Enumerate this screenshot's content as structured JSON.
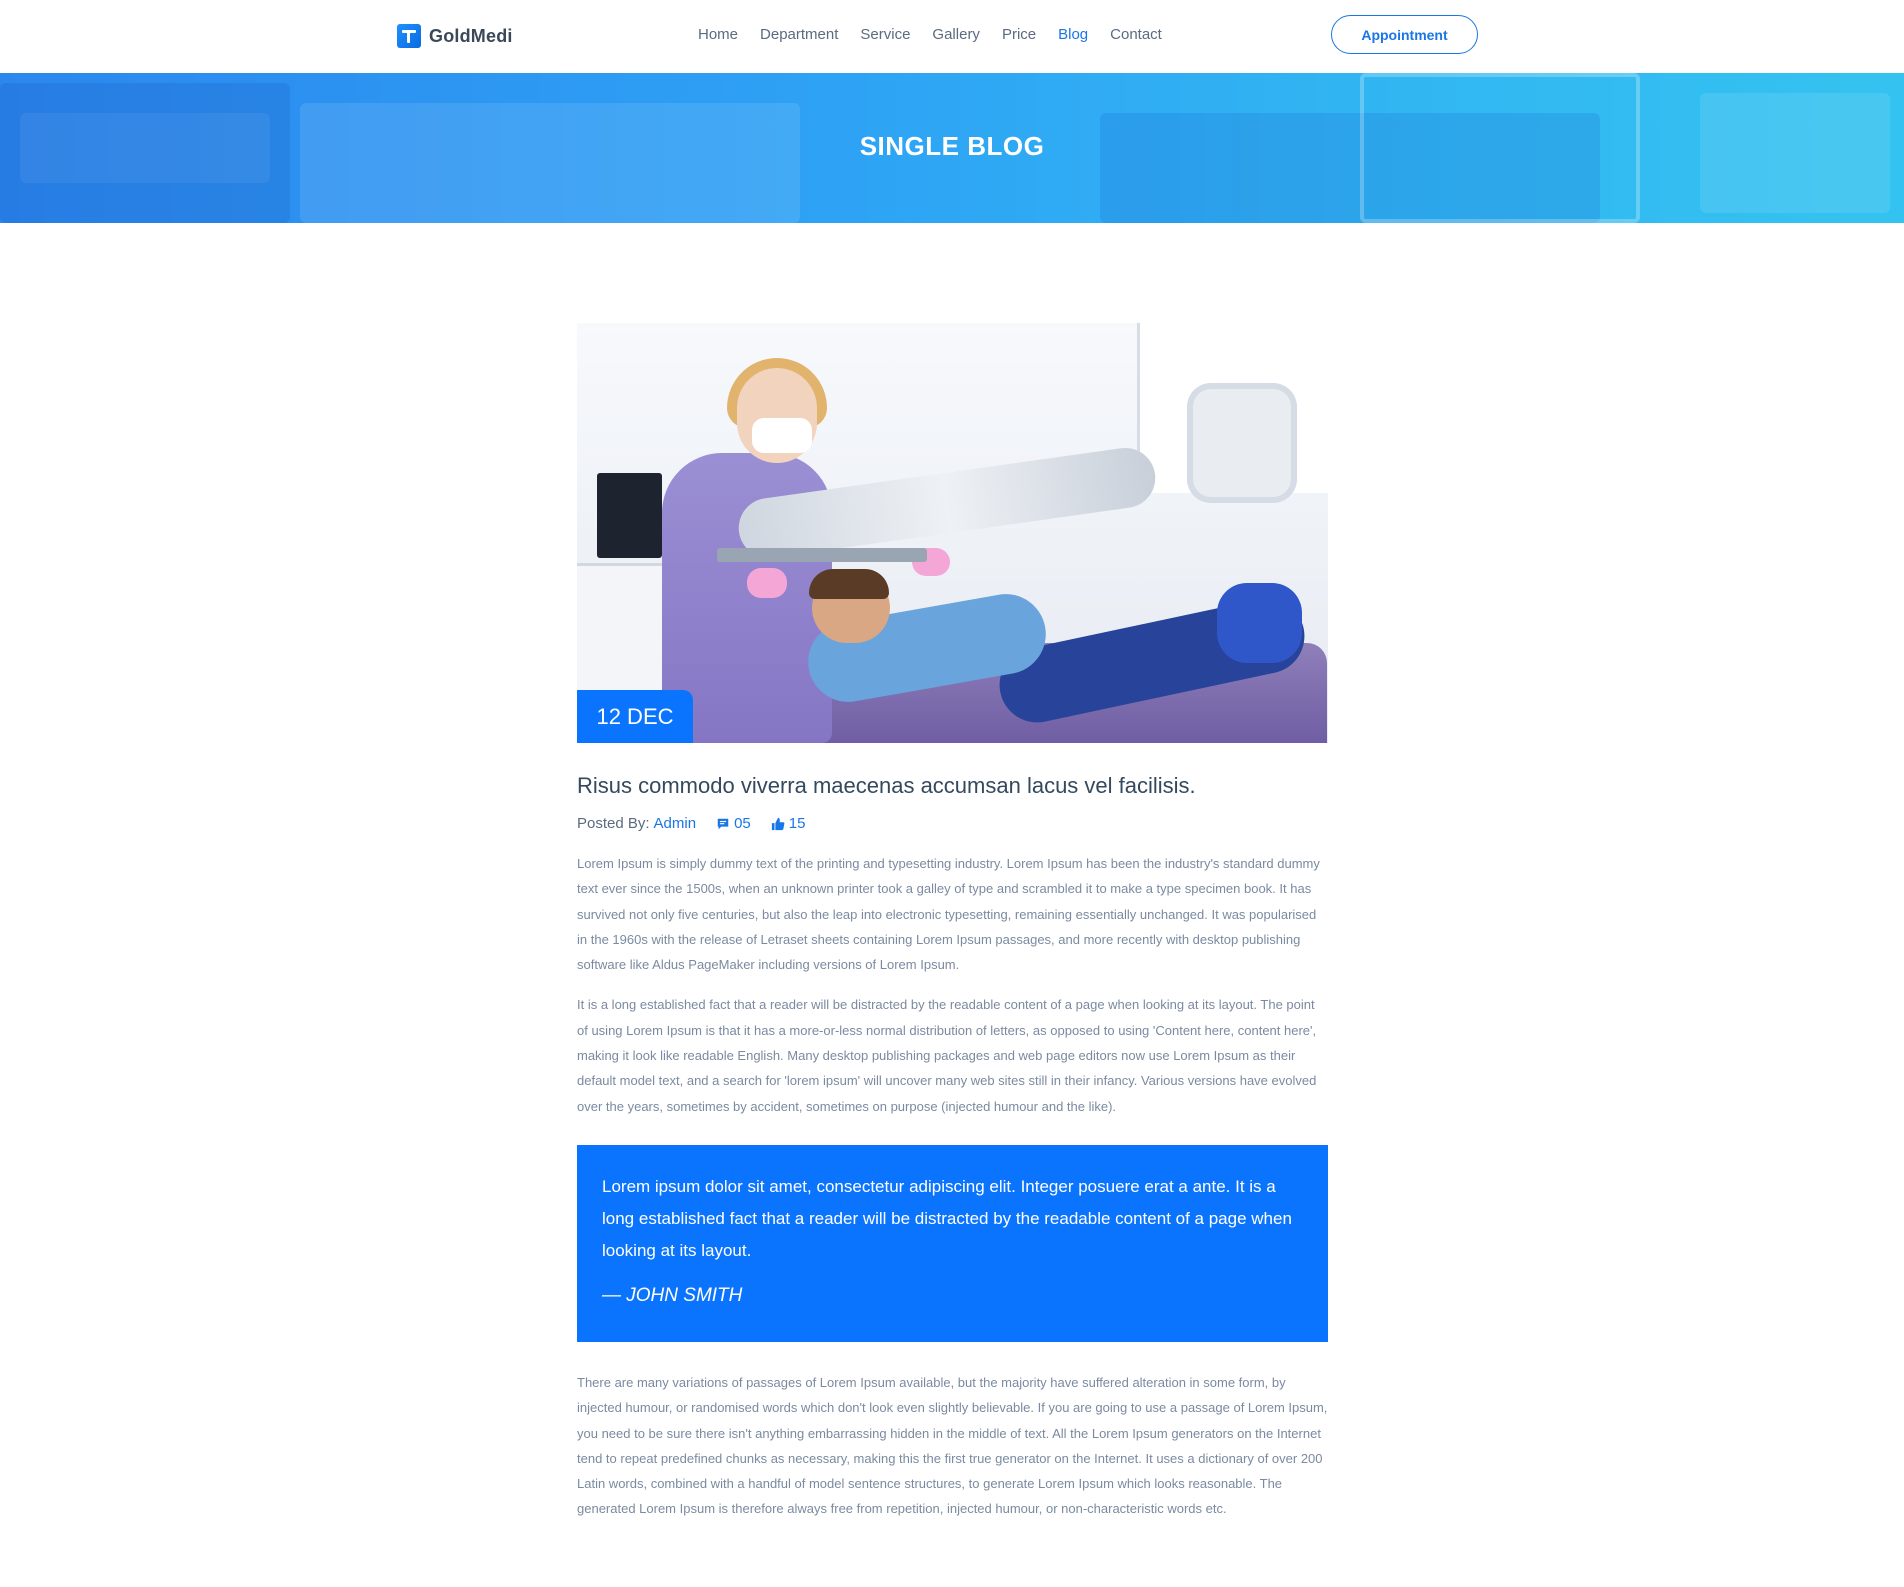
{
  "header": {
    "brand": "GoldMedi",
    "nav": [
      "Home",
      "Department",
      "Service",
      "Gallery",
      "Price",
      "Blog",
      "Contact"
    ],
    "active_nav": "Blog",
    "appointment_label": "Appointment"
  },
  "banner": {
    "title": "SINGLE BLOG"
  },
  "post": {
    "date": "12 DEC",
    "title": "Risus commodo viverra maecenas accumsan lacus vel facilisis.",
    "posted_by_label": "Posted By:",
    "author": "Admin",
    "comments": "05",
    "likes": "15",
    "paragraph_1": "Lorem Ipsum is simply dummy text of the printing and typesetting industry. Lorem Ipsum has been the industry's standard dummy text ever since the 1500s, when an unknown printer took a galley of type and scrambled it to make a type specimen book. It has survived not only five centuries, but also the leap into electronic typesetting, remaining essentially unchanged. It was popularised in the 1960s with the release of Letraset sheets containing Lorem Ipsum passages, and more recently with desktop publishing software like Aldus PageMaker including versions of Lorem Ipsum.",
    "paragraph_2": "It is a long established fact that a reader will be distracted by the readable content of a page when looking at its layout. The point of using Lorem Ipsum is that it has a more-or-less normal distribution of letters, as opposed to using 'Content here, content here', making it look like readable English. Many desktop publishing packages and web page editors now use Lorem Ipsum as their default model text, and a search for 'lorem ipsum' will uncover many web sites still in their infancy. Various versions have evolved over the years, sometimes by accident, sometimes on purpose (injected humour and the like).",
    "quote_text": "Lorem ipsum dolor sit amet, consectetur adipiscing elit. Integer posuere erat a ante. It is a long established fact that a reader will be distracted by the readable content of a page when looking at its layout.",
    "quote_author": "— JOHN SMITH",
    "paragraph_3": "There are many variations of passages of Lorem Ipsum available, but the majority have suffered alteration in some form, by injected humour, or randomised words which don't look even slightly believable. If you are going to use a passage of Lorem Ipsum, you need to be sure there isn't anything embarrassing hidden in the middle of text. All the Lorem Ipsum generators on the Internet tend to repeat predefined chunks as necessary, making this the first true generator on the Internet. It uses a dictionary of over 200 Latin words, combined with a handful of model sentence structures, to generate Lorem Ipsum which looks reasonable. The generated Lorem Ipsum is therefore always free from repetition, injected humour, or non-characteristic words etc."
  },
  "icons": {
    "logo": "medical-cross-logo-icon",
    "comments": "comment-icon",
    "likes": "thumbs-up-icon"
  },
  "colors": {
    "accent": "#0b74ff",
    "link": "#1976e6",
    "body_text": "#7b8aa0",
    "heading": "#34495e",
    "banner_start": "#2b87ee",
    "banner_end": "#34c3f0"
  }
}
